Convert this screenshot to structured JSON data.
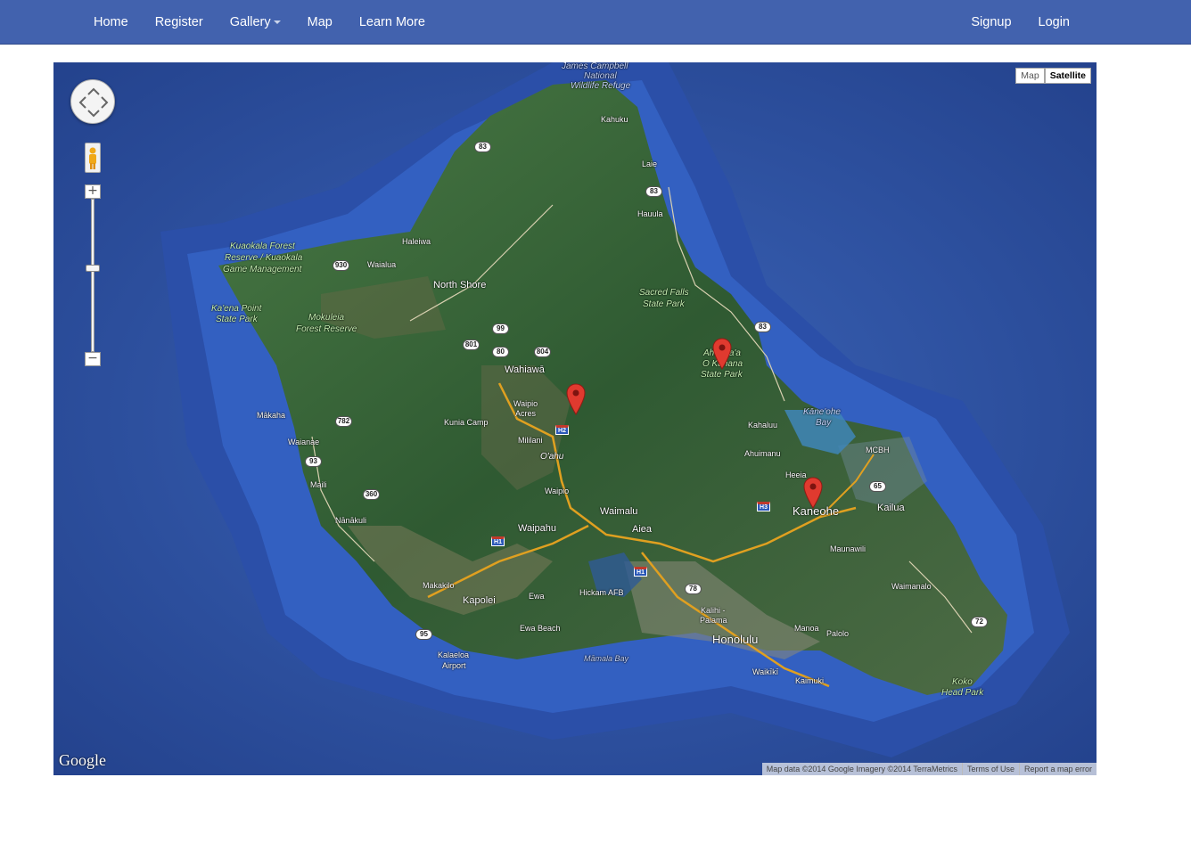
{
  "nav": {
    "left": [
      {
        "label": "Home"
      },
      {
        "label": "Register"
      },
      {
        "label": "Gallery"
      },
      {
        "label": "Map"
      },
      {
        "label": "Learn More"
      }
    ],
    "right": [
      {
        "label": "Signup"
      },
      {
        "label": "Login"
      }
    ]
  },
  "map": {
    "type_buttons": {
      "map": "Map",
      "satellite": "Satellite",
      "active": "Satellite"
    },
    "zoom": {
      "in": "+",
      "out": "−"
    },
    "logo": "Google",
    "attribution": {
      "data": "Map data ©2014 Google Imagery ©2014 TerraMetrics",
      "terms": "Terms of Use",
      "report": "Report a map error"
    },
    "markers": [
      "Mililani marker",
      "Ahupua'a O Kahana marker",
      "Kaneohe marker"
    ],
    "labels": {
      "james_campbell": "James Campbell",
      "national": "National",
      "wildlife_refuge": "Wildlife Refuge",
      "kahuku": "Kahuku",
      "laie": "Laie",
      "hauula": "Hauula",
      "haleiwa": "Haleiwa",
      "waialua": "Waialua",
      "north_shore": "North Shore",
      "kuaokala_1": "Kuaokala Forest",
      "kuaokala_2": "Reserve / Kuaokala",
      "kuaokala_3": "Game Management",
      "kaena_1": "Ka'ena Point",
      "kaena_2": "State Park",
      "mokuleia_1": "Mokuleia",
      "mokuleia_2": "Forest Reserve",
      "sacred_1": "Sacred Falls",
      "sacred_2": "State Park",
      "ahupuaa_1": "Ahupua'a",
      "ahupuaa_2": "O Kahana",
      "ahupuaa_3": "State Park",
      "wahiawa": "Wahiawā",
      "waipio_acres_1": "Waipio",
      "waipio_acres_2": "Acres",
      "kunia_camp": "Kunia Camp",
      "mililani": "Mililani",
      "oahu": "O'ahu",
      "waipio": "Waipio",
      "makaha": "Mākaha",
      "waianae": "Waianae",
      "maili": "Maili",
      "nanakuli": "Nānākuli",
      "waipahu": "Waipahu",
      "waimalu": "Waimalu",
      "aiea": "Aiea",
      "kahaluu": "Kahaluu",
      "kaneohe_bay_1": "Kāne'ohe",
      "kaneohe_bay_2": "Bay",
      "ahuimanu": "Ahuimanu",
      "heeia": "Heeia",
      "kaneohe": "Kaneohe",
      "mcbh": "MCBH",
      "kailua": "Kailua",
      "maunawili": "Maunawili",
      "waimanalo": "Waimanalo",
      "makakilo": "Makakilo",
      "kapolei": "Kapolei",
      "ewa": "Ewa",
      "hickam": "Hickam AFB",
      "ewa_beach": "Ewa Beach",
      "kalaeloa_1": "Kalaeloa",
      "kalaeloa_2": "Airport",
      "mamala_bay": "Māmala Bay",
      "kalihi_1": "Kalihi -",
      "kalihi_2": "Palama",
      "honolulu": "Honolulu",
      "manoa": "Manoa",
      "palolo": "Palolo",
      "waikiki": "Waikīkī",
      "kaimuki": "Kaimuki",
      "koko_1": "Koko",
      "koko_2": "Head Park"
    },
    "shields": {
      "r83a": "83",
      "r83b": "83",
      "r83c": "83",
      "r930": "930",
      "r99": "99",
      "r801": "801",
      "r80": "80",
      "r804": "804",
      "r782": "782",
      "r93": "93",
      "r360": "360",
      "r65": "65",
      "r78": "78",
      "r72": "72",
      "r95": "95"
    },
    "interstates": {
      "h1a": "H1",
      "h1b": "H1",
      "h2": "H2",
      "h3": "H3"
    }
  },
  "colors": {
    "navbar": "#4262ae",
    "ocean_deep": "#2c4c9a",
    "ocean_shallow": "#3a63b8",
    "land": "#3f6a3c",
    "marker": "#e03a2f"
  }
}
